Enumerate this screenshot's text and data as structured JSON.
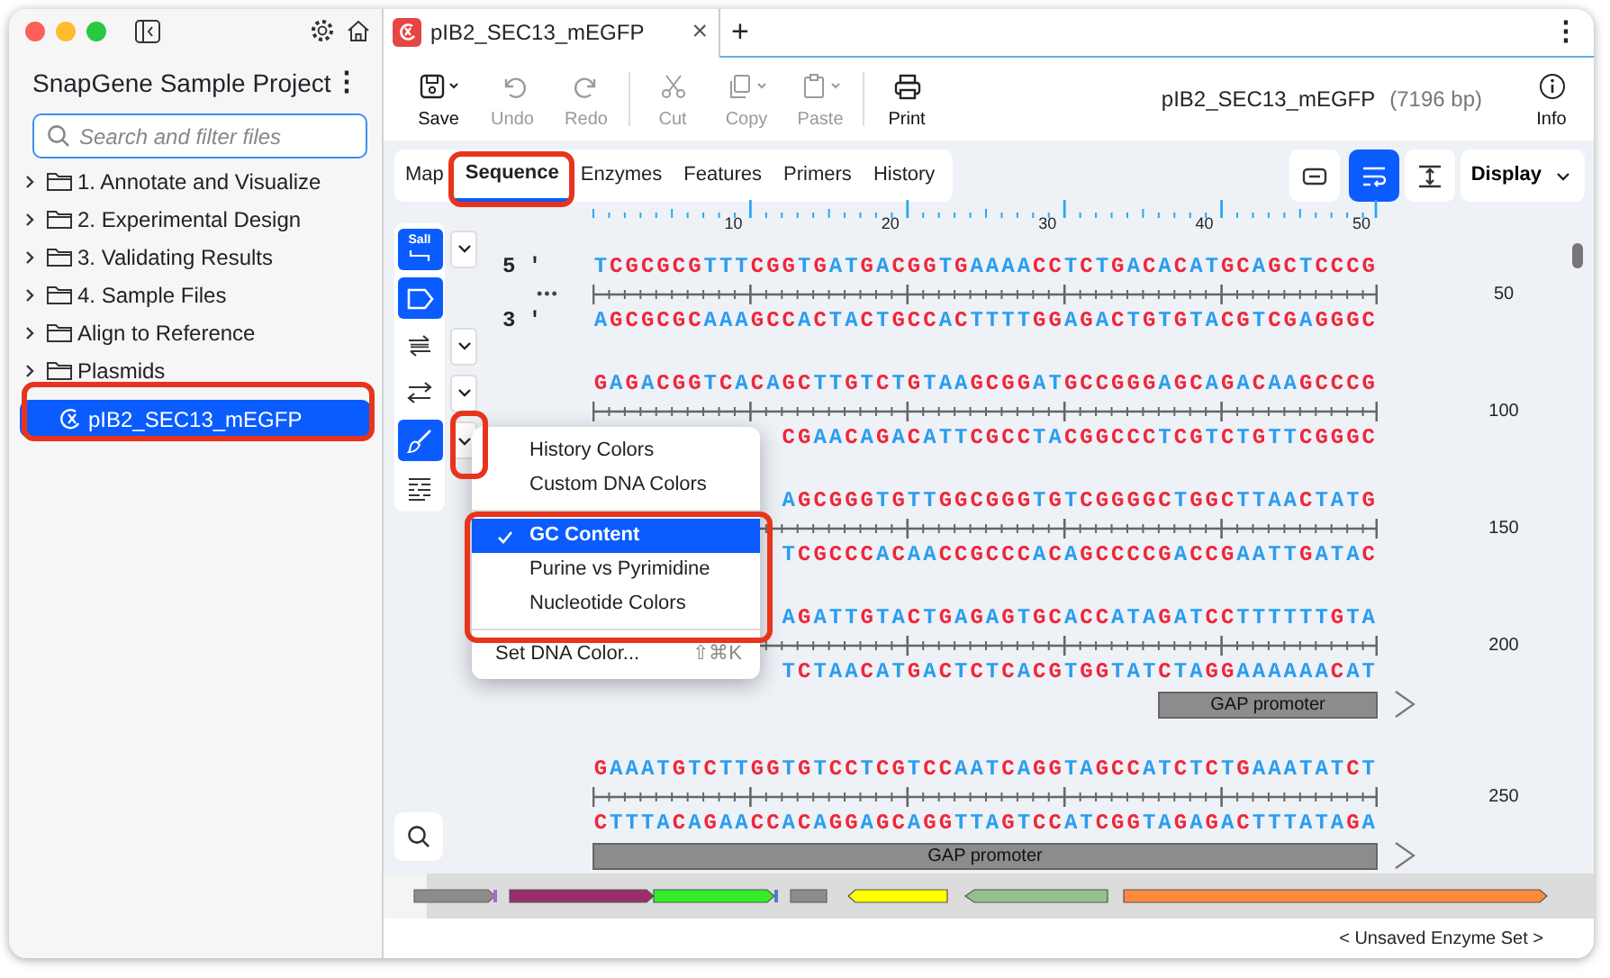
{
  "sidebar": {
    "title": "SnapGene Sample Project",
    "menu_icon": "⋮",
    "search": {
      "placeholder": "Search and filter files"
    },
    "items": [
      {
        "label": "1. Annotate and Visualize",
        "kind": "folder",
        "selected": false
      },
      {
        "label": "2. Experimental Design",
        "kind": "folder",
        "selected": false
      },
      {
        "label": "3. Validating Results",
        "kind": "folder",
        "selected": false
      },
      {
        "label": "4. Sample Files",
        "kind": "folder",
        "selected": false
      },
      {
        "label": "Align to Reference",
        "kind": "folder",
        "selected": false
      },
      {
        "label": "Plasmids",
        "kind": "folder",
        "selected": false
      },
      {
        "label": "pIB2_SEC13_mEGFP",
        "kind": "file",
        "selected": true
      }
    ]
  },
  "document_tabs": [
    {
      "label": "pIB2_SEC13_mEGFP",
      "close": "×",
      "selected": true
    }
  ],
  "new_tab": "+",
  "tab_menu": "⋮",
  "toolbar": {
    "buttons": [
      {
        "label": "Save",
        "kind": "save",
        "disabled": false,
        "menu": true
      },
      {
        "label": "Undo",
        "kind": "undo",
        "disabled": true,
        "menu": false
      },
      {
        "label": "Redo",
        "kind": "redo",
        "disabled": true,
        "menu": false
      },
      {
        "label": "Cut",
        "kind": "cut",
        "disabled": true,
        "menu": false
      },
      {
        "label": "Copy",
        "kind": "copy",
        "disabled": true,
        "menu": true
      },
      {
        "label": "Paste",
        "kind": "paste",
        "disabled": true,
        "menu": true
      },
      {
        "label": "Print",
        "kind": "print",
        "disabled": false,
        "menu": false
      }
    ],
    "document_name": "pIB2_SEC13_mEGFP",
    "length": "(7196 bp)",
    "info": "Info"
  },
  "view_tabs": [
    {
      "label": "Map",
      "selected": false
    },
    {
      "label": "Sequence",
      "selected": true
    },
    {
      "label": "Enzymes",
      "selected": false
    },
    {
      "label": "Features",
      "selected": false
    },
    {
      "label": "Primers",
      "selected": false
    },
    {
      "label": "History",
      "selected": false
    }
  ],
  "view_buttons": [
    {
      "kind": "collapse",
      "selected": false
    },
    {
      "kind": "wrap",
      "selected": true
    },
    {
      "kind": "fit",
      "selected": false
    }
  ],
  "display_button": "Display",
  "tools": [
    {
      "kind": "enzymes",
      "label": "SalI",
      "selected": true,
      "menu": true
    },
    {
      "kind": "features",
      "selected": true,
      "menu": false
    },
    {
      "kind": "strands",
      "selected": false,
      "menu": true
    },
    {
      "kind": "translate",
      "selected": false,
      "menu": true
    },
    {
      "kind": "colors",
      "selected": true,
      "menu": true
    },
    {
      "kind": "list",
      "selected": false,
      "menu": false
    }
  ],
  "sequence": {
    "ruler": [
      "10",
      "20",
      "30",
      "40",
      "50"
    ],
    "top_end": "5 '",
    "bottom_end": "3 '",
    "ellipsis": "•••",
    "rows": [
      {
        "top": "TCGCGCGTTTCGGTGATGACGGTGAAAACCTCTGACACATGCAGCTCCCG",
        "bottom": "AGCGCGCAAAGCCACTACTGCCACTTTTGGAGACTGTGTACGTCGAGGGC",
        "number": "50"
      },
      {
        "top": "GAGACGGTCACAGCTTGTCTGTAAGCGGATGCCGGGAGCAGACAAGCCCG",
        "bottom": "CGAACAGACATTCGCCTACGGCCCTCGTCTGTTCGGGC",
        "number": "100"
      },
      {
        "top": "AGCGGGTGTTGGCGGGTGTCGGGGCTGGCTTAACTATG",
        "bottom": "TCGCCCACAACCGCCCACAGCCCCGACCGAATTGATAC",
        "number": "150"
      },
      {
        "top": "AGATTGTACTGAGAGTGCACCATAGATCCTTTTTTGTA",
        "bottom": "TCTAACATGACTCTCACGTGGTATCTAGGAAAAAACAT",
        "number": "200",
        "feature": {
          "label": "GAP promoter",
          "kind": "end"
        }
      },
      {
        "top": "GAAATGTCTTGGTGTCCTCGTCCAATCAGGTAGCCATCTCTGAAATATCT",
        "bottom": "CTTTACAGAACCACAGGAGCAGGTTAGTCCATCGGTAGAGACTTTATAGA",
        "number": "250",
        "feature": {
          "label": "GAP promoter",
          "kind": "full"
        }
      }
    ]
  },
  "color_menu": {
    "items": [
      {
        "kind": "history",
        "label": "History Colors",
        "checked": false,
        "selected": false
      },
      {
        "kind": "custom",
        "label": "Custom DNA Colors",
        "checked": false,
        "selected": false
      },
      {
        "kind": "separator"
      },
      {
        "kind": "gc",
        "label": "GC Content",
        "checked": true,
        "selected": true
      },
      {
        "kind": "purine",
        "label": "Purine vs Pyrimidine",
        "checked": false,
        "selected": false
      },
      {
        "kind": "nucleotide",
        "label": "Nucleotide Colors",
        "checked": false,
        "selected": false
      },
      {
        "kind": "separator"
      },
      {
        "kind": "action",
        "label": "Set DNA Color...",
        "shortcut": "⇧⌘K",
        "checked": false,
        "selected": false
      }
    ]
  },
  "status_bar": {
    "enzyme_set": "< Unsaved Enzyme Set >"
  }
}
